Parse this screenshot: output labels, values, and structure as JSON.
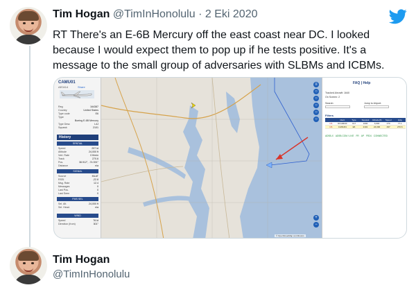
{
  "tweet": {
    "author_name": "Tim Hogan",
    "author_handle": "@TimInHonolulu",
    "separator": "·",
    "date": "2 Eki 2020",
    "text": "RT There's an E-6B Mercury off the east coast near DC.  I looked because I would expect them to pop up if he tests positive.  It's a message to the small group of adversaries  with SLBMs and ICBMs.",
    "brand_icon": "twitter-bird-icon",
    "brand_color": "#1d9bf0"
  },
  "embedded_screenshot": {
    "left_panel": {
      "callsign": "CAMU01",
      "sub_id": "AE0414",
      "track_link": "Share",
      "history_label": "History",
      "rows_top": [
        {
          "label": "Reg",
          "value": "164387"
        },
        {
          "label": "Country",
          "value": "United States"
        },
        {
          "label": "Type code",
          "value": "E6"
        },
        {
          "label": "Type",
          "value": ""
        },
        {
          "label": "",
          "value": "Boeing E-6B Mercury"
        },
        {
          "label": "Type Desc",
          "value": "L4J"
        },
        {
          "label": "Squawk",
          "value": "2101"
        }
      ],
      "section_spatial": "SPATIAL",
      "rows_spatial": [
        {
          "label": "Speed",
          "value": "297 kt"
        },
        {
          "label": "Altitude",
          "value": "24,000 ft"
        },
        {
          "label": "Vert. Rate",
          "value": "0 ft/min"
        },
        {
          "label": "Track",
          "value": "270.6"
        },
        {
          "label": "Pos.",
          "value": "38.912°, -74.391°"
        },
        {
          "label": "Distance",
          "value": "n/a"
        }
      ],
      "section_signal": "SIGNAL",
      "rows_signal": [
        {
          "label": "Source",
          "value": "MLAT"
        },
        {
          "label": "RSSI",
          "value": "-22.8"
        },
        {
          "label": "Msg. Rate",
          "value": "12.4"
        },
        {
          "label": "Messages",
          "value": "0"
        },
        {
          "label": "Last Pos.",
          "value": "0"
        },
        {
          "label": "Last Seen",
          "value": "0"
        }
      ],
      "section_fms": "FMS SEL",
      "rows_fms": [
        {
          "label": "Sel. Alt.",
          "value": "24,000 ft"
        },
        {
          "label": "Sel. Head.",
          "value": "n/a"
        }
      ],
      "section_wind": "WIND",
      "rows_wind": [
        {
          "label": "Speed",
          "value": "76 kt"
        },
        {
          "label": "Direction (from)",
          "value": "301°"
        }
      ]
    },
    "right_panel": {
      "faq": "FAQ | Help",
      "lines": [
        "Tracked Aircraft: 1640",
        "On Screen: 2"
      ],
      "search_label": "Search:",
      "jump_label": "Jump to Airport:",
      "filters": "Filters",
      "table_headers": [
        "",
        "Ident",
        "Type",
        "Squawk",
        "Altitude(ft)",
        "Speed",
        "Hdg"
      ],
      "table_rows": [
        {
          "flag": "US",
          "cells": [
            "RCH9040",
            "C17",
            "1000",
            "6,900",
            "270",
            "77.1"
          ],
          "selected": false
        },
        {
          "flag": "US",
          "cells": [
            "CAMU01",
            "E6",
            "2101",
            "24,000",
            "297",
            "270.6"
          ],
          "selected": true
        }
      ],
      "links": [
        "ADSB-X",
        "ADSB.COM / LIVE",
        "FR",
        "AP",
        "FR24",
        "CONNECTED"
      ]
    },
    "map": {
      "attribution": "© OpenStreetMap contributors",
      "land_color": "#e6e2da",
      "water_color": "#9eb8d8",
      "track_color": "#2d5fcf",
      "arrow_color": "#d8342a",
      "aircraft_color": "#e8d200"
    }
  },
  "reply": {
    "author_name": "Tim Hogan",
    "author_handle": "@TimInHonolulu"
  }
}
